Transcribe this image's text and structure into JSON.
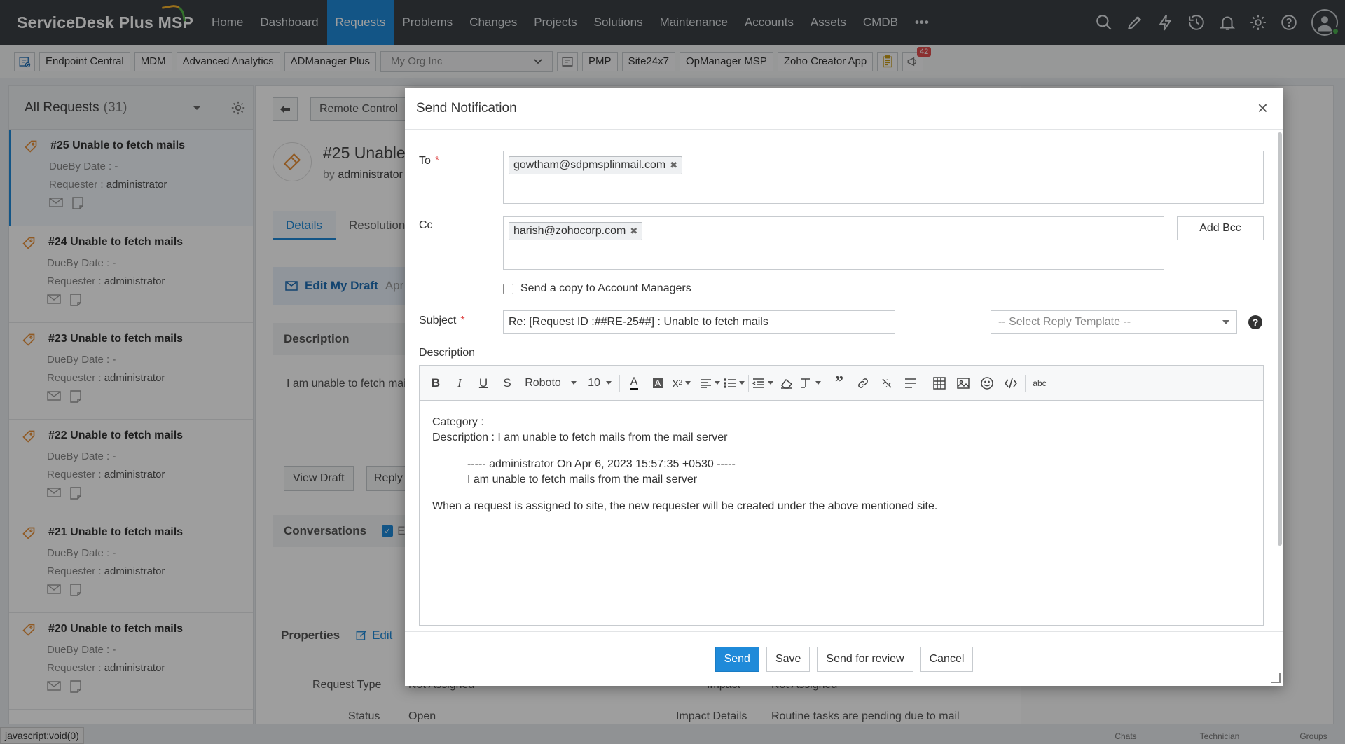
{
  "app": {
    "brand": "ServiceDesk Plus MSP",
    "nav": [
      "Home",
      "Dashboard",
      "Requests",
      "Problems",
      "Changes",
      "Projects",
      "Solutions",
      "Maintenance",
      "Accounts",
      "Assets",
      "CMDB",
      "•••"
    ],
    "active_nav": "Requests",
    "accent": "#1f8ad9"
  },
  "toolbar": {
    "items": [
      "Endpoint Central",
      "MDM",
      "Advanced Analytics",
      "ADManager Plus"
    ],
    "org_select": "My Org Inc",
    "items2": [
      "PMP",
      "Site24x7",
      "OpManager MSP",
      "Zoho Creator App"
    ],
    "badge_count": "42"
  },
  "list": {
    "title": "All Requests",
    "count": "(31)",
    "due_label": "DueBy Date : -",
    "requester_label": "Requester :",
    "requester_value": "administrator",
    "items": [
      {
        "title": "#25 Unable to fetch mails"
      },
      {
        "title": "#24 Unable to fetch mails"
      },
      {
        "title": "#23 Unable to fetch mails"
      },
      {
        "title": "#22 Unable to fetch mails"
      },
      {
        "title": "#21 Unable to fetch mails"
      },
      {
        "title": "#20 Unable to fetch mails"
      }
    ]
  },
  "detail": {
    "remote_control": "Remote Control",
    "title": "#25  Unable",
    "by": "by",
    "by_name": "administrator",
    "tabs": [
      "Details",
      "Resolution"
    ],
    "edit_draft": "Edit My Draft",
    "draft_date": "Apr",
    "description_header": "Description",
    "description_text": "I am unable to fetch mails",
    "view_draft": "View Draft",
    "reply": "Reply",
    "conversations": "Conversations",
    "conv_filter": "E-",
    "properties": "Properties",
    "edit": "Edit",
    "request_type_label": "Request Type",
    "request_type_value": "Not Assigned",
    "impact_label": "Impact",
    "impact_value": "Not Assigned",
    "status_label": "Status",
    "status_value": "Open",
    "impact_details_label": "Impact Details",
    "impact_details_value": "Routine tasks are pending due to mail"
  },
  "status_bar": "javascript:void(0)",
  "bottom_tabs": [
    "Chats",
    "Technician",
    "Groups"
  ],
  "modal": {
    "title": "Send Notification",
    "to_label": "To",
    "to_chips": [
      "gowtham@sdpmsplinmail.com"
    ],
    "cc_label": "Cc",
    "cc_chips": [
      "harish@zohocorp.com"
    ],
    "add_bcc": "Add Bcc",
    "copy_label": "Send a copy to Account Managers",
    "subject_label": "Subject",
    "subject_value": "Re: [Request ID :##RE-25##] : Unable to fetch mails",
    "template_placeholder": "-- Select Reply Template --",
    "help": "?",
    "description_label": "Description",
    "editor": {
      "font": "Roboto",
      "size": "10",
      "line1": "Category :",
      "line2": "Description : I am unable to fetch mails from the mail server",
      "quote_head": "----- administrator On Apr 6, 2023 15:57:35 +0530 -----",
      "quote_body": "I am unable to fetch mails from the mail server",
      "note": "When a request is assigned to site, the new requester will be created under the above mentioned site."
    },
    "buttons": {
      "send": "Send",
      "save": "Save",
      "review": "Send for review",
      "cancel": "Cancel"
    }
  }
}
